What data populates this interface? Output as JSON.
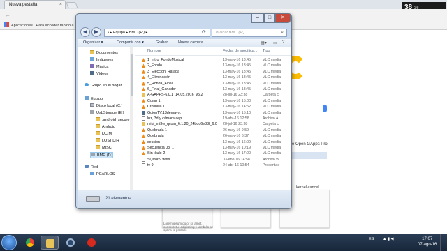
{
  "browser": {
    "tab_title": "Nueva pestaña",
    "bookmarks_label": "Aplicaciones",
    "bookmarks_hint": "Para acceder rápido a",
    "widget_time": "38",
    "widget_sub": "36",
    "gapps_text": "e Open GApps Pro",
    "thumb_label": "kernel-cancel",
    "thumb_caption": "Lorem ipsum dolor sit amet, consectetur adipiscing y también se aplica la pantalla"
  },
  "explorer": {
    "address": [
      "Equipo",
      "BMC (F:)"
    ],
    "search_placeholder": "Buscar BMC (F:)",
    "toolbar": {
      "organize": "Organizar",
      "share": "Compartir con",
      "burn": "Grabar",
      "new_folder": "Nueva carpeta"
    },
    "nav_items": [
      {
        "label": "Documentos",
        "icon": "documents-icon"
      },
      {
        "label": "Imágenes",
        "icon": "pictures-icon"
      },
      {
        "label": "Música",
        "icon": "music-icon"
      },
      {
        "label": "Vídeos",
        "icon": "videos-icon"
      },
      {
        "label": "Grupo en el hogar",
        "icon": "homegroup-icon"
      },
      {
        "label": "Equipo",
        "icon": "computer-icon"
      },
      {
        "label": "Disco local (C:)",
        "icon": "drive-icon"
      },
      {
        "label": "UsbStorage (E:)",
        "icon": "usb-drive-icon"
      },
      {
        "label": ".android_secure",
        "icon": "folder-icon"
      },
      {
        "label": "Android",
        "icon": "folder-icon"
      },
      {
        "label": "DCIM",
        "icon": "folder-icon"
      },
      {
        "label": "LOST.DIR",
        "icon": "folder-icon"
      },
      {
        "label": "MISC",
        "icon": "folder-icon"
      },
      {
        "label": "BMC (F:)",
        "icon": "usb-drive-icon"
      },
      {
        "label": "Red",
        "icon": "network-icon"
      },
      {
        "label": "PCARLOS",
        "icon": "computer-icon"
      }
    ],
    "columns": {
      "name": "Nombre",
      "date": "Fecha de modifica...",
      "type": "Tipo"
    },
    "files": [
      {
        "name": "1_Intro_FondoMusical",
        "date": "13-may-16 13:45",
        "type": "VLC media",
        "icon": "vlc"
      },
      {
        "name": "2_Fondo",
        "date": "13-may-16 13:45",
        "type": "VLC media",
        "icon": "vlc"
      },
      {
        "name": "3_Eleccion_Rafaga",
        "date": "13-may-16 13:45",
        "type": "VLC media",
        "icon": "vlc"
      },
      {
        "name": "4_Eliminación",
        "date": "13-may-16 13:45",
        "type": "VLC media",
        "icon": "vlc"
      },
      {
        "name": "5_Ronda_Final",
        "date": "13-may-16 13:45",
        "type": "VLC media",
        "icon": "vlc"
      },
      {
        "name": "6_Final_Ganador",
        "date": "13-may-16 13:45",
        "type": "VLC media",
        "icon": "vlc"
      },
      {
        "name": "A-GAPPS-6.0.1_14.05.2016_v5.2",
        "date": "28-jul-16 23:38",
        "type": "Carpeta c",
        "icon": "folder"
      },
      {
        "name": "Comp 1",
        "date": "13-may-16 15:00",
        "type": "VLC media",
        "icon": "vlc"
      },
      {
        "name": "Crotinilla 1",
        "date": "13-may-16 14:52",
        "type": "VLC media",
        "icon": "vlc"
      },
      {
        "name": "GuionTV.13demayo.",
        "date": "13-may-16 15:10",
        "type": "VLC media",
        "icon": "vid"
      },
      {
        "name": "luz, 3d y cámara.aep",
        "date": "19-abr-16 12:58",
        "type": "Archivo A",
        "icon": "gen"
      },
      {
        "name": "miui_mi3w_qcom_6.1.20_24bdd6e83f_6.0",
        "date": "28-jul-16 23:38",
        "type": "Carpeta c",
        "icon": "folder"
      },
      {
        "name": "Quebrada 1",
        "date": "26-may-16 9:59",
        "type": "VLC media",
        "icon": "vlc"
      },
      {
        "name": "Quebrada",
        "date": "26-may-16 6:37",
        "type": "VLC media",
        "icon": "vlc"
      },
      {
        "name": "seccion",
        "date": "13-may-16 16:09",
        "type": "VLC media",
        "icon": "vlc"
      },
      {
        "name": "Secuencia 03_1",
        "date": "13-may-16 10:19",
        "type": "VLC media",
        "icon": "vlc"
      },
      {
        "name": "Sin título-2",
        "date": "13-may-16 17:00",
        "type": "VLC media",
        "icon": "vlc"
      },
      {
        "name": "SQV869.wbfs",
        "date": "03-ene-16 14:58",
        "type": "Archivo W",
        "icon": "gen"
      },
      {
        "name": "tv 9",
        "date": "24-abr-16 10:54",
        "type": "Presentac",
        "icon": "gen"
      }
    ],
    "item_count": "21 elementos"
  },
  "taskbar": {
    "lang": "ES",
    "time": "17:07",
    "date": "07-ago-16"
  },
  "colors": {
    "vlc_orange": "#f08a16",
    "folder_yellow": "#e8c357",
    "close_red": "#c74a3a"
  }
}
